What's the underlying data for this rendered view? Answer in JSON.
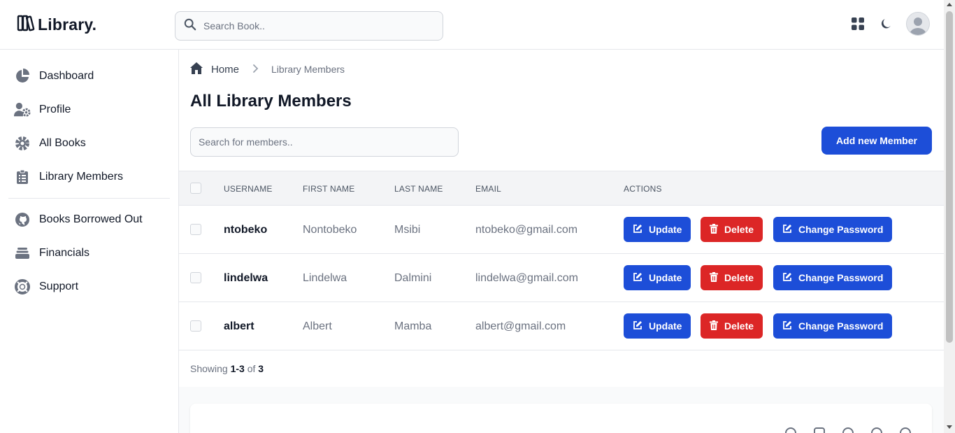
{
  "app": {
    "title": "Library."
  },
  "search": {
    "placeholder": "Search Book.."
  },
  "sidebar": {
    "items": [
      {
        "label": "Dashboard",
        "icon": "chart-pie-icon"
      },
      {
        "label": "Profile",
        "icon": "user-gear-icon"
      },
      {
        "label": "All Books",
        "icon": "gear-icon"
      },
      {
        "label": "Library Members",
        "icon": "clipboard-list-icon"
      }
    ],
    "items2": [
      {
        "label": "Books Borrowed Out",
        "icon": "github-icon"
      },
      {
        "label": "Financials",
        "icon": "layers-icon"
      },
      {
        "label": "Support",
        "icon": "life-ring-icon"
      }
    ]
  },
  "breadcrumb": {
    "home": "Home",
    "current": "Library Members"
  },
  "main": {
    "title": "All Library Members",
    "search_placeholder": "Search for members..",
    "add_button": "Add new Member"
  },
  "table": {
    "headers": [
      "USERNAME",
      "FIRST NAME",
      "LAST NAME",
      "EMAIL",
      "ACTIONS"
    ],
    "rows": [
      {
        "username": "ntobeko",
        "first": "Nontobeko",
        "last": "Msibi",
        "email": "ntobeko@gmail.com"
      },
      {
        "username": "lindelwa",
        "first": "Lindelwa",
        "last": "Dalmini",
        "email": "lindelwa@gmail.com"
      },
      {
        "username": "albert",
        "first": "Albert",
        "last": "Mamba",
        "email": "albert@gmail.com"
      }
    ],
    "actions": {
      "update": "Update",
      "delete": "Delete",
      "change_password": "Change Password"
    }
  },
  "pagination": {
    "prefix": "Showing",
    "range": "1-3",
    "of": "of",
    "total": "3"
  },
  "colors": {
    "primary": "#1d4ed8",
    "danger": "#dc2626",
    "border": "#e5e7eb",
    "muted": "#6b7280"
  }
}
